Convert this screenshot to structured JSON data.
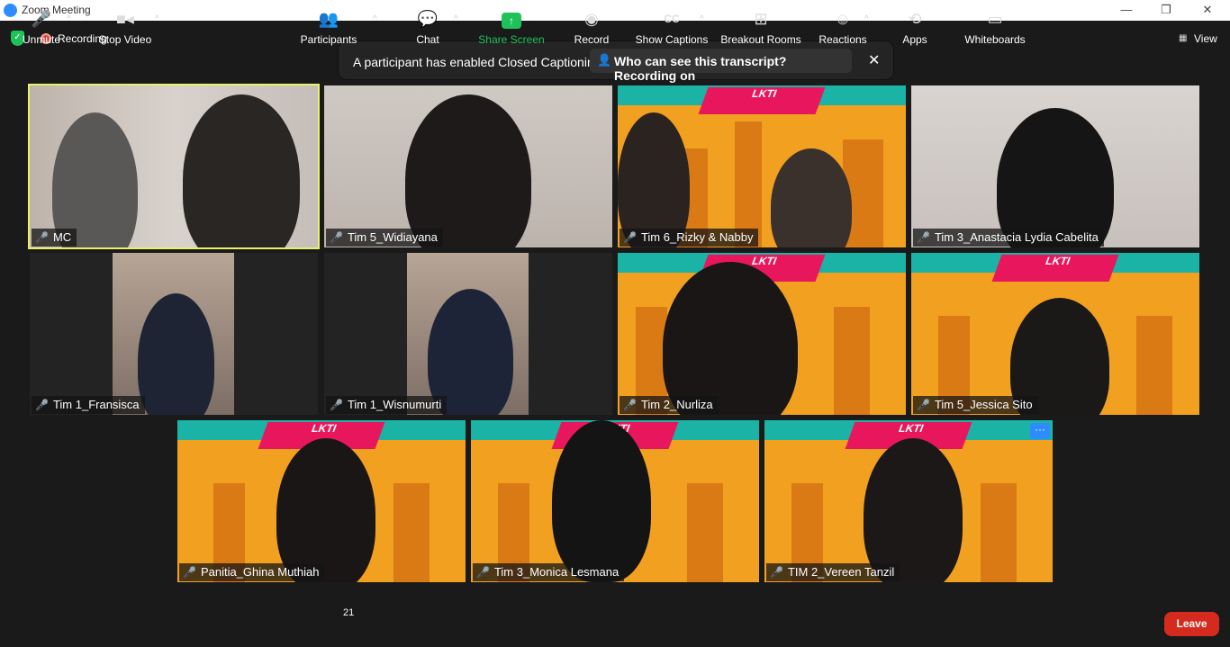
{
  "window": {
    "title": "Zoom Meeting",
    "minimize": "—",
    "restore": "❐",
    "close": "✕"
  },
  "top": {
    "recording_label": "Recording",
    "view_label": "View"
  },
  "notice": {
    "message": "A participant has enabled Closed Captioning",
    "pill_label": "Who can see this transcript? Recording on",
    "close": "✕"
  },
  "tiles": [
    {
      "name": "MC"
    },
    {
      "name": "Tim 5_Widiayana"
    },
    {
      "name": "Tim 6_Rizky & Nabby"
    },
    {
      "name": "Tim 3_Anastacia Lydia Cabelita"
    },
    {
      "name": "Tim 1_Fransisca"
    },
    {
      "name": "Tim 1_Wisnumurti"
    },
    {
      "name": "Tim 2_Nurliza"
    },
    {
      "name": "Tim 5_Jessica Sito"
    },
    {
      "name": "Panitia_Ghina Muthiah"
    },
    {
      "name": "Tim 3_Monica Lesmana"
    },
    {
      "name": "TIM 2_Vereen Tanzil"
    }
  ],
  "poster": {
    "title": "LKTI"
  },
  "toolbar": {
    "unmute": "Unmute",
    "stop_video": "Stop Video",
    "participants": "Participants",
    "participants_count": "21",
    "chat": "Chat",
    "share_screen": "Share Screen",
    "record": "Record",
    "show_captions": "Show Captions",
    "breakout_rooms": "Breakout Rooms",
    "reactions": "Reactions",
    "apps": "Apps",
    "whiteboards": "Whiteboards",
    "leave": "Leave"
  },
  "colors": {
    "accent": "#2d8cff",
    "active_speaker": "#e6f26a",
    "leave": "#d52b1e",
    "share": "#1fc25a"
  }
}
